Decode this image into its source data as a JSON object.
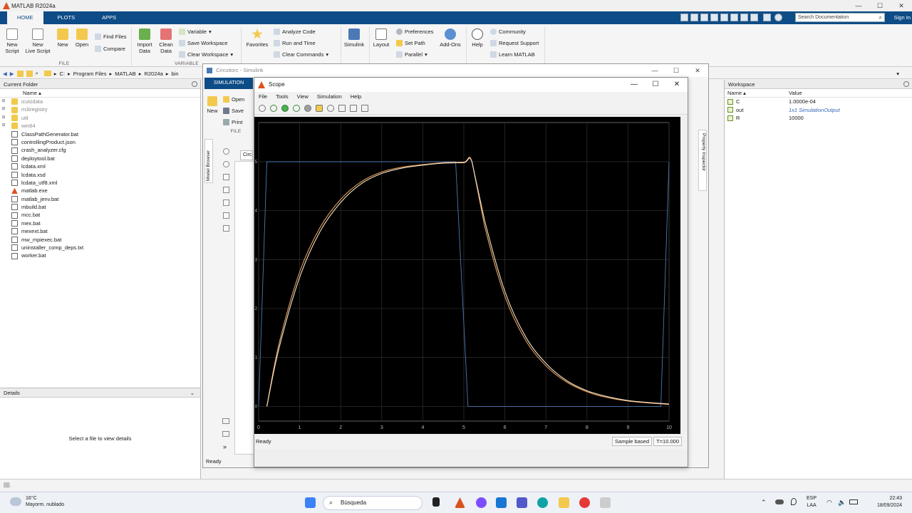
{
  "app": {
    "title": "MATLAB R2024a"
  },
  "ribbon": {
    "tabs": [
      "HOME",
      "PLOTS",
      "APPS"
    ],
    "search_placeholder": "Search Documentation",
    "sign_in": "Sign In",
    "file": {
      "new_script": "New\nScript",
      "new_live_script": "New\nLive Script",
      "new": "New",
      "open": "Open",
      "find_files": "Find Files",
      "compare": "Compare",
      "label": "FILE"
    },
    "variable": {
      "import_data": "Import\nData",
      "clean_data": "Clean\nData",
      "variable": "Variable",
      "save_workspace": "Save Workspace",
      "clear_workspace": "Clear Workspace",
      "label": "VARIABLE"
    },
    "code": {
      "favorites": "Favorites",
      "analyze_code": "Analyze Code",
      "run_and_time": "Run and Time",
      "clear_commands": "Clear Commands"
    },
    "simulink": {
      "simulink": "Simulink"
    },
    "environment": {
      "layout": "Layout",
      "preferences": "Preferences",
      "set_path": "Set Path",
      "parallel": "Parallel",
      "add_ons": "Add-Ons"
    },
    "resources": {
      "help": "Help",
      "community": "Community",
      "request_support": "Request Support",
      "learn_matlab": "Learn MATLAB"
    }
  },
  "address": {
    "segments": [
      "C:",
      "Program Files",
      "MATLAB",
      "R2024a",
      "bin"
    ]
  },
  "current_folder": {
    "title": "Current Folder",
    "column": "Name",
    "items": [
      {
        "name": "icutzdata",
        "type": "folder"
      },
      {
        "name": "m3iregistry",
        "type": "folder"
      },
      {
        "name": "util",
        "type": "folder"
      },
      {
        "name": "win64",
        "type": "folder"
      },
      {
        "name": "ClassPathGenerator.bat",
        "type": "file"
      },
      {
        "name": "controllingProduct.json",
        "type": "file"
      },
      {
        "name": "crash_analyzer.cfg",
        "type": "file"
      },
      {
        "name": "deploytool.bat",
        "type": "file"
      },
      {
        "name": "lcdata.xml",
        "type": "file"
      },
      {
        "name": "lcdata.xsd",
        "type": "file"
      },
      {
        "name": "lcdata_utf8.xml",
        "type": "file"
      },
      {
        "name": "matlab.exe",
        "type": "matlab"
      },
      {
        "name": "matlab_jenv.bat",
        "type": "file"
      },
      {
        "name": "mbuild.bat",
        "type": "file"
      },
      {
        "name": "mcc.bat",
        "type": "file"
      },
      {
        "name": "mex.bat",
        "type": "file"
      },
      {
        "name": "mexext.bat",
        "type": "file"
      },
      {
        "name": "mw_mpiexec.bat",
        "type": "file"
      },
      {
        "name": "uninstaller_comp_deps.txt",
        "type": "file"
      },
      {
        "name": "worker.bat",
        "type": "file"
      }
    ]
  },
  "details": {
    "title": "Details",
    "empty_text": "Select a file to view details"
  },
  "workspace": {
    "title": "Workspace",
    "col_name": "Name",
    "col_value": "Value",
    "rows": [
      {
        "name": "C",
        "value": "1.0000e-04"
      },
      {
        "name": "out",
        "value": "1x1 SimulationOutput"
      },
      {
        "name": "R",
        "value": "10000"
      }
    ]
  },
  "simulink": {
    "title": "Circuitorc - Simulink",
    "tab": "SIMULATION",
    "new": "New",
    "open": "Open",
    "save": "Save",
    "print": "Print",
    "file_label": "FILE",
    "model_browser": "Model Browser",
    "property_inspector": "Property Inspector",
    "canvas_label": "Circ",
    "status": "Ready"
  },
  "scope": {
    "title": "Scope",
    "menu": [
      "File",
      "Tools",
      "View",
      "Simulation",
      "Help"
    ],
    "status": "Ready",
    "sample_based": "Sample based",
    "time": "T=10.000"
  },
  "chart_data": {
    "type": "line",
    "xlim": [
      0,
      10
    ],
    "ylim": [
      -0.3,
      5.8
    ],
    "x_ticks": [
      0,
      1,
      2,
      3,
      4,
      5,
      6,
      7,
      8,
      9,
      10
    ],
    "y_ticks": [
      0,
      1,
      2,
      3,
      4,
      5
    ],
    "grid": true,
    "background": "#000000",
    "series": [
      {
        "color": "#4a7ab5",
        "x": [
          0,
          0.2,
          4.8,
          5.1,
          9.8,
          10
        ],
        "y": [
          0,
          5,
          5,
          0,
          0,
          5
        ]
      },
      {
        "color": "#e8a15a",
        "x": [
          0.2,
          0.5,
          1.0,
          1.5,
          2.0,
          2.5,
          3.0,
          3.5,
          4.0,
          4.5,
          5.0,
          5.2,
          5.5,
          6.0,
          6.5,
          7.0,
          7.5,
          8.0,
          8.5,
          9.0,
          9.5,
          10.0
        ],
        "y": [
          0,
          1.29,
          2.75,
          3.66,
          4.23,
          4.59,
          4.79,
          4.89,
          4.94,
          4.98,
          4.99,
          5.0,
          3.71,
          2.25,
          1.36,
          0.83,
          0.5,
          0.3,
          0.18,
          0.11,
          0.07,
          0.04
        ]
      },
      {
        "color": "#f5e3c8",
        "x": [
          0.2,
          0.5,
          1.0,
          1.5,
          2.0,
          2.5,
          3.0,
          3.5,
          4.0,
          4.5,
          5.0,
          5.2,
          5.5,
          6.0,
          6.5,
          7.0,
          7.5,
          8.0,
          8.5,
          9.0,
          9.5,
          10.0
        ],
        "y": [
          0,
          1.2,
          2.64,
          3.58,
          4.17,
          4.55,
          4.76,
          4.87,
          4.93,
          4.97,
          4.98,
          4.99,
          3.82,
          2.35,
          1.43,
          0.88,
          0.53,
          0.32,
          0.2,
          0.12,
          0.08,
          0.05
        ]
      }
    ]
  },
  "taskbar": {
    "temperature": "16°C",
    "weather": "Mayorm. nublado",
    "search": "Búsqueda",
    "lang1": "ESP",
    "lang2": "LAA",
    "time": "22:43",
    "date": "18/09/2024"
  }
}
